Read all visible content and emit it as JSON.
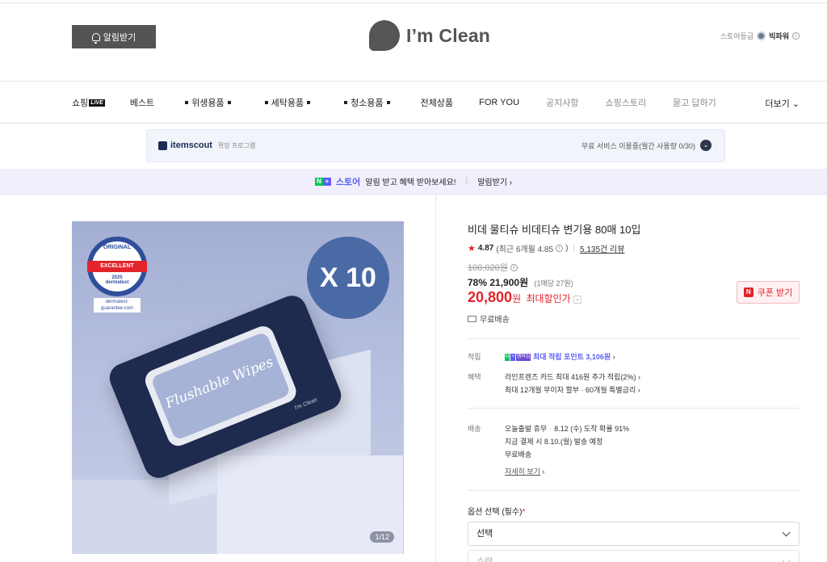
{
  "header": {
    "alarm_button": "알림받기",
    "brand_name": "I’m Clean",
    "store_grade_label": "스토어등급",
    "store_grade_name": "빅파워"
  },
  "nav": {
    "items": [
      {
        "label": "쇼핑",
        "badge": "LIVE"
      },
      {
        "label": "베스트"
      },
      {
        "label": "위생용품"
      },
      {
        "label": "세탁용품"
      },
      {
        "label": "청소용품"
      },
      {
        "label": "전체상품"
      },
      {
        "label": "FOR YOU"
      },
      {
        "label": "공지사항"
      },
      {
        "label": "쇼핑스토리"
      },
      {
        "label": "묻고 답하기"
      }
    ],
    "more": "더보기"
  },
  "itemscout": {
    "name": "itemscout",
    "sub": "확장 프로그램",
    "status": "무료 서비스 이용중(월간 사용량 0/30)"
  },
  "naver_banner": {
    "store": "스토어",
    "message": "알림 받고 혜택 받아보세요!",
    "link": "알림받기"
  },
  "image": {
    "badge_text": "X 10",
    "derma_top": "ORIGINAL",
    "derma_band": "EXCELLENT",
    "derma_bottom": "dermatest",
    "derma_year": "2025",
    "derma_url": "dermatest-guarantee.com",
    "pack_text": "Flushable Wipes",
    "pack_brand": "I'm Clean",
    "pager": "1/12"
  },
  "product": {
    "title": "비데 물티슈 비데티슈 변기용 80매 10입",
    "rating": "4.87",
    "rating_recent": "(최근 6개월 4.85",
    "reviews": "5,135건 리뷰",
    "original_price": "100,020원",
    "discount": "78%",
    "discount_price": "21,900원",
    "unit_price": "(1매당 27원)",
    "final_price": "20,800",
    "final_won": "원",
    "final_label": "최대할인가",
    "coupon": "쿠폰 받기",
    "shipping": "무료배송"
  },
  "benefits": {
    "points_label": "적립",
    "npay_tag": "멤버십",
    "points_value": "최대 적립 포인트 3,106원",
    "benefit_label": "혜택",
    "benefit_line1": "라인프렌즈 카드 최대 416원 추가 적립(2%)",
    "benefit_line2": "최대 12개월 무이자 할부 · 60개월 특별금리",
    "delivery_label": "배송",
    "delivery_line1a": "오늘출발 휴무",
    "delivery_line1b": "8.12 (수) 도착 확률 91%",
    "delivery_line2": "지금 결제 시 8.10.(월) 발송 예정",
    "delivery_line3": "무료배송",
    "detail_link": "자세히 보기"
  },
  "options": {
    "label": "옵션 선택 (필수)",
    "required_mark": "*",
    "select_value": "선택",
    "quantity_placeholder": "수량"
  }
}
